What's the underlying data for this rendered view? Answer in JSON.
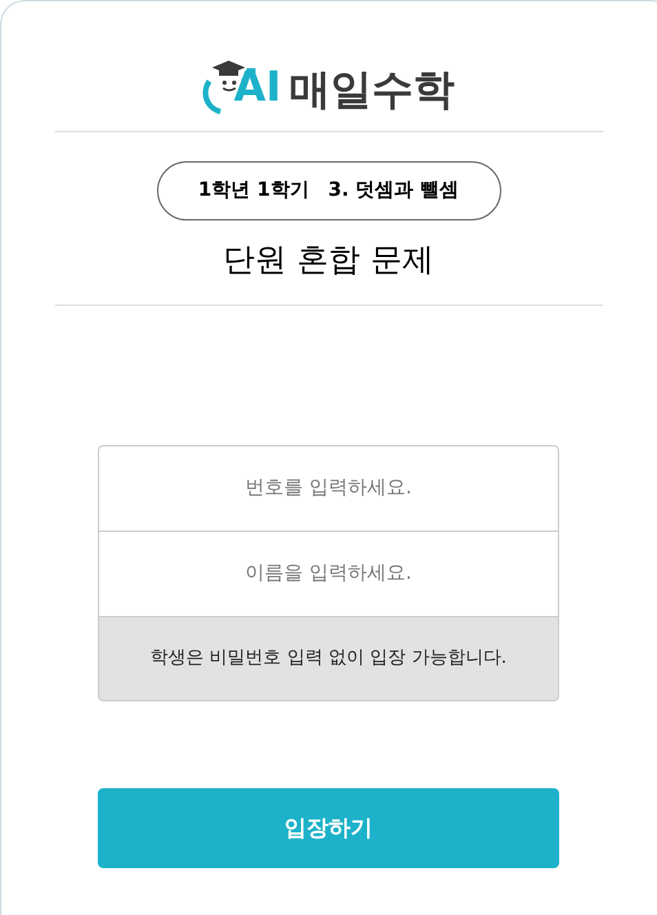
{
  "logo": {
    "mark": "AI",
    "name": "매일수학"
  },
  "unit_badge": {
    "grade": "1학년 1학기",
    "unit": "3. 덧셈과 뺄셈"
  },
  "title": "단원 혼합 문제",
  "fields": [
    {
      "placeholder": "번호를 입력하세요."
    },
    {
      "placeholder": "이름을 입력하세요."
    }
  ],
  "notice": "학생은 비밀번호 입력 없이 입장 가능합니다.",
  "enter_button": "입장하기"
}
